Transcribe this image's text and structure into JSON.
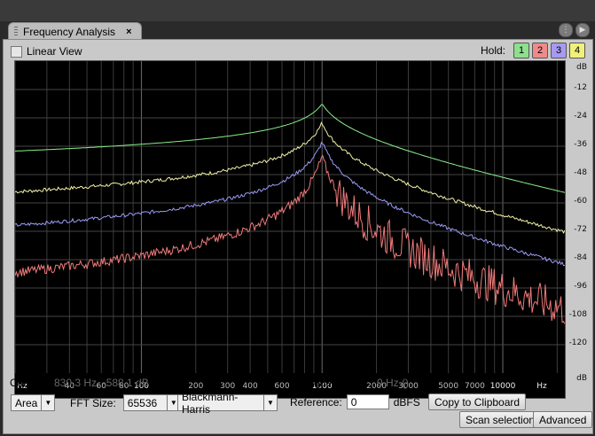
{
  "tab": {
    "title": "Frequency Analysis",
    "close": "×"
  },
  "linear_view_label": "Linear View",
  "hold": {
    "label": "Hold:",
    "buttons": [
      {
        "label": "1",
        "color": "#8ee08e"
      },
      {
        "label": "2",
        "color": "#f08a8a"
      },
      {
        "label": "3",
        "color": "#a79af0"
      },
      {
        "label": "4",
        "color": "#f0f07a"
      }
    ]
  },
  "chart_data": {
    "type": "line",
    "x_scale": "log",
    "xlim": [
      20,
      22050
    ],
    "ylim": [
      -132,
      0
    ],
    "x_unit_left": "Hz",
    "x_unit_right": "Hz",
    "y_unit": "dB",
    "x_ticks": [
      {
        "value": 40,
        "label": "40",
        "major": false
      },
      {
        "value": 60,
        "label": "60",
        "major": false
      },
      {
        "value": 80,
        "label": "80",
        "major": false
      },
      {
        "value": 100,
        "label": "100",
        "major": true
      },
      {
        "value": 200,
        "label": "200",
        "major": false
      },
      {
        "value": 300,
        "label": "300",
        "major": false
      },
      {
        "value": 400,
        "label": "400",
        "major": false
      },
      {
        "value": 600,
        "label": "600",
        "major": false
      },
      {
        "value": 1000,
        "label": "1000",
        "major": true
      },
      {
        "value": 2000,
        "label": "2000",
        "major": false
      },
      {
        "value": 3000,
        "label": "3000",
        "major": false
      },
      {
        "value": 5000,
        "label": "5000",
        "major": false
      },
      {
        "value": 7000,
        "label": "7000",
        "major": false
      },
      {
        "value": 10000,
        "label": "10000",
        "major": true
      }
    ],
    "y_ticks": [
      -12,
      -24,
      -36,
      -48,
      -60,
      -72,
      -84,
      -96,
      -108,
      -120
    ],
    "y_tick_labels": [
      "-12",
      "-24",
      "-36",
      "-48",
      "-60",
      "-72",
      "-84",
      "-96",
      "-108",
      "-120"
    ],
    "series": [
      {
        "color": "#8cf08c",
        "peak_db": -18,
        "floor_db": -72,
        "falloff": 13,
        "spikes": []
      },
      {
        "color": "#f0f0a8",
        "peak_db": -26,
        "floor_db": -87,
        "falloff": 19,
        "spikes": [
          {
            "f": 60,
            "db": -84
          },
          {
            "f": 180,
            "db": -84
          },
          {
            "f": 420,
            "db": -86
          },
          {
            "f": 3000,
            "db": -96
          },
          {
            "f": 7000,
            "db": -101
          },
          {
            "f": 9000,
            "db": -102
          },
          {
            "f": 13000,
            "db": -104
          },
          {
            "f": 18000,
            "db": -106
          }
        ]
      },
      {
        "color": "#9a9af5",
        "peak_db": -34,
        "floor_db": -96,
        "falloff": 23,
        "spikes": [
          {
            "f": 60,
            "db": -93
          },
          {
            "f": 180,
            "db": -93
          },
          {
            "f": 420,
            "db": -95
          },
          {
            "f": 3000,
            "db": -104
          },
          {
            "f": 5000,
            "db": -106
          },
          {
            "f": 7000,
            "db": -108
          },
          {
            "f": 13000,
            "db": -112
          }
        ]
      },
      {
        "color": "#f07a7a",
        "peak_db": -40,
        "floor_db": -114,
        "falloff": 32,
        "spikes": [
          {
            "f": 60,
            "db": -101
          },
          {
            "f": 120,
            "db": -108
          },
          {
            "f": 180,
            "db": -100
          },
          {
            "f": 300,
            "db": -109
          },
          {
            "f": 420,
            "db": -99
          },
          {
            "f": 500,
            "db": -107
          },
          {
            "f": 600,
            "db": -104
          },
          {
            "f": 700,
            "db": -104
          },
          {
            "f": 2000,
            "db": -108
          },
          {
            "f": 3000,
            "db": -110
          },
          {
            "f": 5000,
            "db": -112
          },
          {
            "f": 7000,
            "db": -112
          }
        ]
      }
    ]
  },
  "status": {
    "cursor_label": "Cursor:",
    "cursor_value": "830.3 Hz, -588.1 dB",
    "frequency_label": "Frequency:",
    "frequency_value": "0 Hz ()"
  },
  "controls": {
    "display_mode": "Area",
    "fft_size_label": "FFT Size:",
    "fft_size": "65536",
    "window": "Blackmann-Harris",
    "reference_label": "Reference:",
    "reference_value": "0",
    "reference_unit": "dBFS",
    "copy_button": "Copy to Clipboard",
    "scan_button": "Scan selection",
    "advanced_button": "Advanced"
  }
}
